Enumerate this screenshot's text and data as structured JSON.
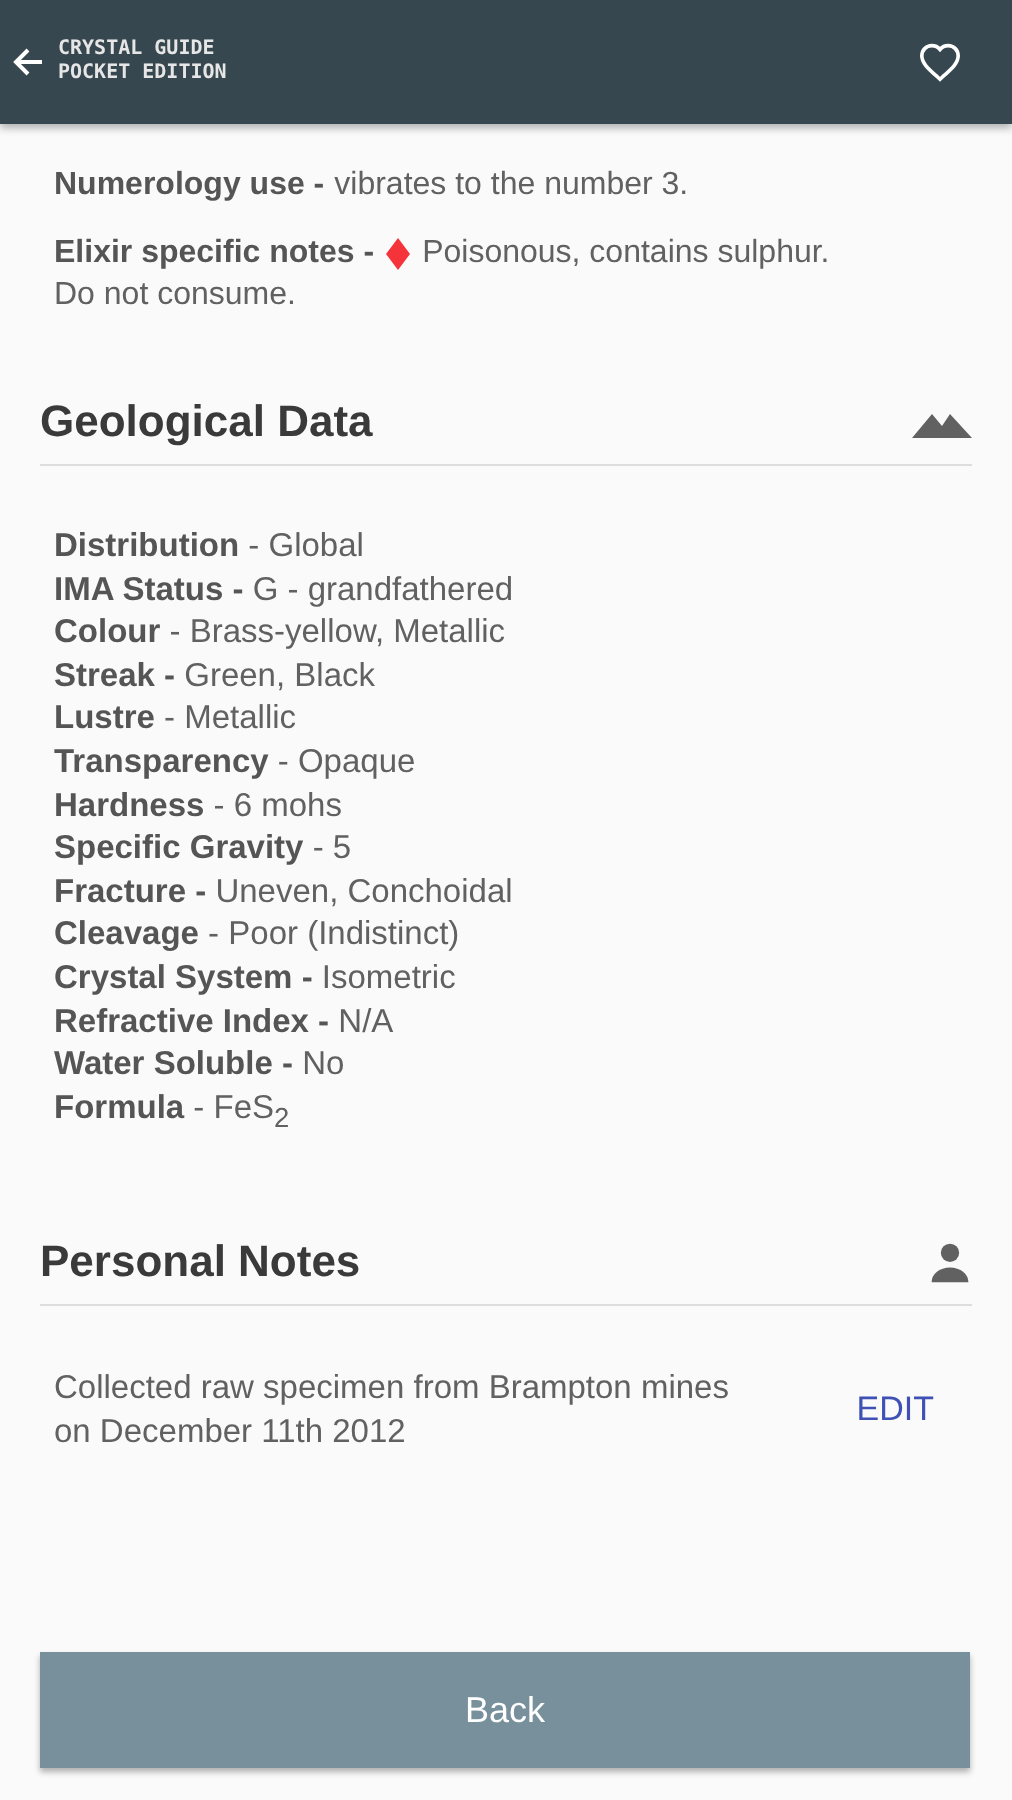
{
  "app_bar": {
    "title_line_1": "CRYSTAL GUIDE",
    "title_line_2": "POCKET EDITION"
  },
  "intro": [
    {
      "label": "Numerology use -",
      "text": [
        "vibrates to the number 3."
      ],
      "warning": false
    },
    {
      "label": "Elixir specific notes -",
      "text": [
        "Poisonous, contains sulphur.",
        "Do not consume."
      ],
      "warning": true
    }
  ],
  "geological": {
    "title": "Geological Data",
    "properties": [
      "**Distribution** - Global",
      "**IMA Status -** G - grandfathered",
      "**Colour** - Brass-yellow, Metallic",
      "**Streak -** Green, Black",
      "**Lustre** - Metallic",
      "**Transparency** - Opaque",
      "**Hardness** - 6 mohs",
      "**Specific Gravity** - 5",
      "**Fracture -** Uneven, Conchoidal",
      "**Cleavage** - Poor (Indistinct)",
      "**Crystal System -** Isometric",
      "**Refractive Index -** N/A",
      "**Water Soluble -** No",
      "**Formula** - FeS$_{2}$"
    ]
  },
  "personal_notes": {
    "title": "Personal Notes",
    "note": "Collected raw specimen from Brampton mines on December 11th 2012",
    "edit": "EDIT"
  },
  "back_button": "Back"
}
